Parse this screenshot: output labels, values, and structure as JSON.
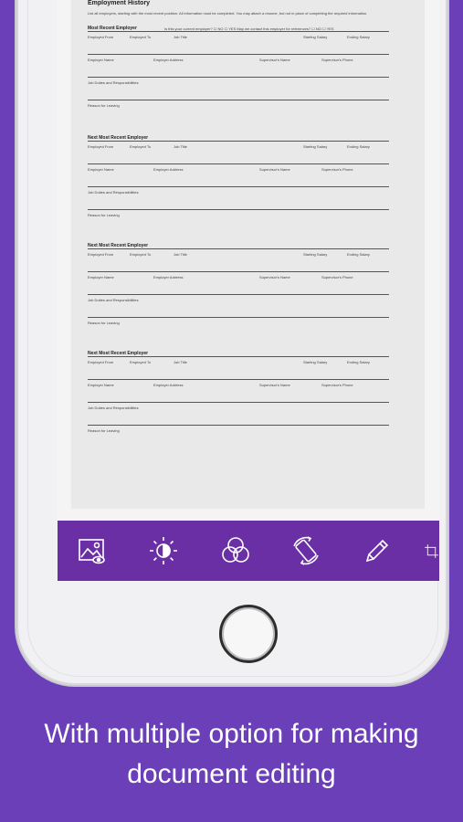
{
  "document": {
    "title": "Employment History",
    "intro": "List all employers, starting with the most recent position. All information must be completed. You may attach a resume, but not in place of completing the required information.",
    "sections": [
      {
        "heading": "Most Recent Employer",
        "note": "Is this your current employer? ☐ NO ☐ YES   May we contact this employer for references? ☐ NO ☐ YES",
        "row1": [
          "Employed From",
          "Employed To",
          "Job Title",
          "Starting Salary",
          "Ending Salary"
        ],
        "row2": [
          "Employer Name",
          "Employer Address",
          "Supervisor's Name",
          "Supervisor's Phone"
        ],
        "row3": "Job Duties and Responsibilities",
        "row4": "Reason for Leaving"
      },
      {
        "heading": "Next Most Recent Employer",
        "note": "",
        "row1": [
          "Employed From",
          "Employed To",
          "Job Title",
          "Starting Salary",
          "Ending Salary"
        ],
        "row2": [
          "Employer Name",
          "Employer Address",
          "Supervisor's Name",
          "Supervisor's Phone"
        ],
        "row3": "Job Duties and Responsibilities",
        "row4": "Reason for Leaving"
      },
      {
        "heading": "Next Most Recent Employer",
        "note": "",
        "row1": [
          "Employed From",
          "Employed To",
          "Job Title",
          "Starting Salary",
          "Ending Salary"
        ],
        "row2": [
          "Employer Name",
          "Employer Address",
          "Supervisor's Name",
          "Supervisor's Phone"
        ],
        "row3": "Job Duties and Responsibilities",
        "row4": "Reason for Leaving"
      },
      {
        "heading": "Next Most Recent Employer",
        "note": "",
        "row1": [
          "Employed From",
          "Employed To",
          "Job Title",
          "Starting Salary",
          "Ending Salary"
        ],
        "row2": [
          "Employer Name",
          "Employer Address",
          "Supervisor's Name",
          "Supervisor's Phone"
        ],
        "row3": "Job Duties and Responsibilities",
        "row4": "Reason for Leaving"
      }
    ]
  },
  "toolbar": {
    "icons": [
      "image-icon",
      "brightness-icon",
      "color-filter-icon",
      "rotate-icon",
      "pencil-icon",
      "crop-icon"
    ]
  },
  "caption": {
    "line1": "With multiple option for making",
    "line2": "document editing"
  },
  "colors": {
    "background": "#6a3fb8",
    "toolbar": "#6a2fa4"
  }
}
